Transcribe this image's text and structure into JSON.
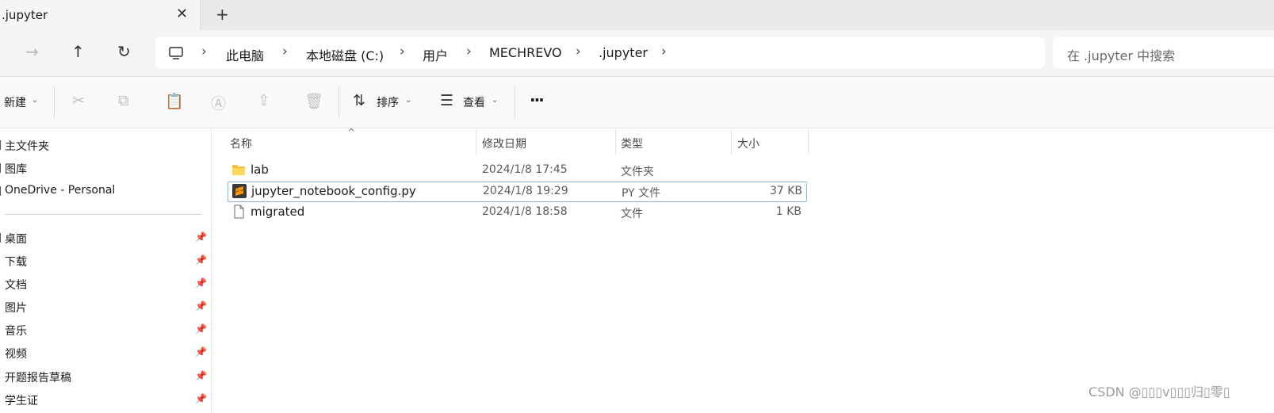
{
  "tab": {
    "title": ".jupyter",
    "close_glyph": "✕",
    "new_tab_glyph": "+"
  },
  "nav": {
    "forward_glyph": "→",
    "up_glyph": "↑",
    "refresh_glyph": "↻",
    "breadcrumb": [
      "此电脑",
      "本地磁盘 (C:)",
      "用户",
      "MECHREVO",
      ".jupyter"
    ],
    "search_placeholder": "在 .jupyter 中搜索"
  },
  "toolbar": {
    "new_label": "新建",
    "sort_label": "排序",
    "view_label": "查看",
    "more_glyph": "···"
  },
  "sidebar": {
    "top_items": [
      "主文件夹",
      "图库",
      "OneDrive - Personal"
    ],
    "quick_access": [
      "桌面",
      "下载",
      "文档",
      "图片",
      "音乐",
      "视频",
      "开题报告草稿",
      "学生证"
    ]
  },
  "columns": {
    "name": "名称",
    "date": "修改日期",
    "type": "类型",
    "size": "大小"
  },
  "files": [
    {
      "name": "lab",
      "date": "2024/1/8 17:45",
      "type": "文件夹",
      "size": "",
      "icon": "folder-icon"
    },
    {
      "name": "jupyter_notebook_config.py",
      "date": "2024/1/8 19:29",
      "type": "PY 文件",
      "size": "37 KB",
      "icon": "sublime-file-icon",
      "selected": true
    },
    {
      "name": "migrated",
      "date": "2024/1/8 18:58",
      "type": "文件",
      "size": "1 KB",
      "icon": "blank-file-icon"
    }
  ],
  "watermark": "CSDN @▯▯▯v▯▯▯归▯零▯",
  "colors": {
    "accent": "#0067c0",
    "selection_border": "#8ab4e6",
    "folder": "#f4c03e",
    "sublime": "#ff9800"
  }
}
